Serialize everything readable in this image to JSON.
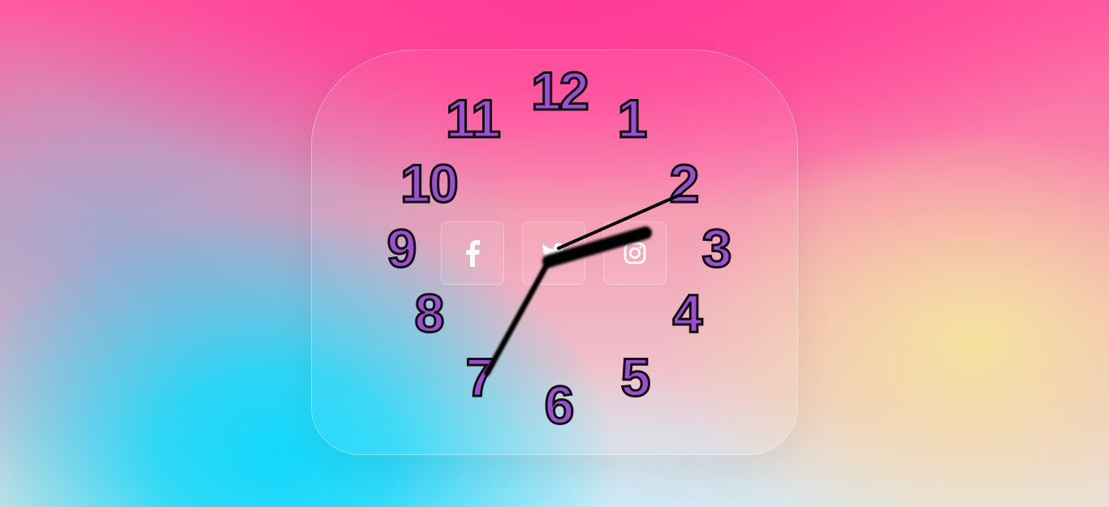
{
  "clock": {
    "numerals": [
      "12",
      "1",
      "2",
      "3",
      "4",
      "5",
      "6",
      "7",
      "8",
      "9",
      "10",
      "11"
    ],
    "numeral_fill": "#9c4fd0",
    "numeral_stroke": "#111111",
    "hand_color": "#000000"
  },
  "social": {
    "items": [
      {
        "name": "facebook-icon",
        "label": "Facebook"
      },
      {
        "name": "twitter-icon",
        "label": "Twitter"
      },
      {
        "name": "instagram-icon",
        "label": "Instagram"
      }
    ],
    "icon_color": "#ffffff"
  },
  "background": {
    "pink": "#ff3a96",
    "cyan": "#12d8fc",
    "yellow": "#f6e2a0"
  }
}
